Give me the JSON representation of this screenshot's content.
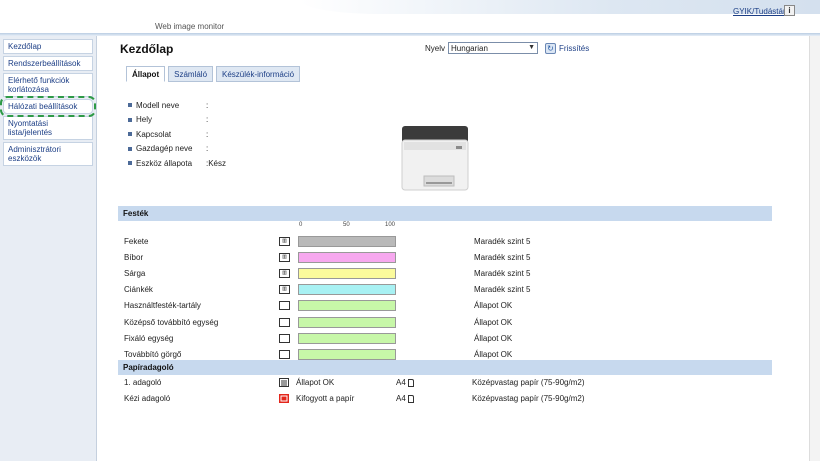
{
  "header": {
    "app_title": "Web image monitor",
    "help_link": "GYIK/Tudástár",
    "info_button": "i"
  },
  "sidebar": {
    "items": [
      {
        "label": "Kezdőlap"
      },
      {
        "label": "Rendszerbeállítások"
      },
      {
        "label": "Elérhető funkciók korlátozása"
      },
      {
        "label": "Hálózati beállítások"
      },
      {
        "label": "Nyomtatási lista/jelentés"
      },
      {
        "label": "Adminisztrátori eszközök"
      }
    ]
  },
  "main": {
    "title": "Kezdőlap",
    "language_label": "Nyelv",
    "language_value": "Hungarian",
    "refresh_label": "Frissítés",
    "tabs": [
      {
        "label": "Állapot"
      },
      {
        "label": "Számláló"
      },
      {
        "label": "Készülék-információ"
      }
    ],
    "info": [
      {
        "label": "Modell neve",
        "value": ":"
      },
      {
        "label": "Hely",
        "value": ":"
      },
      {
        "label": "Kapcsolat",
        "value": ":"
      },
      {
        "label": "Gazdagép neve",
        "value": ":"
      },
      {
        "label": "Eszköz állapota",
        "value": ":Kész"
      }
    ]
  },
  "toner": {
    "header": "Festék",
    "scale": [
      "0",
      "50",
      "100"
    ],
    "rows": [
      {
        "name": "Fekete",
        "status": "Maradék szint 5",
        "level": 1.0,
        "color": "#b9b9b9"
      },
      {
        "name": "Bíbor",
        "status": "Maradék szint 5",
        "level": 1.0,
        "color": "#f7a8ef"
      },
      {
        "name": "Sárga",
        "status": "Maradék szint 5",
        "level": 1.0,
        "color": "#fbfb9c"
      },
      {
        "name": "Ciánkék",
        "status": "Maradék szint 5",
        "level": 1.0,
        "color": "#a8f1f3"
      },
      {
        "name": "Használtfesték-tartály",
        "status": "Állapot OK",
        "level": 1.0,
        "color": "#c7f7a8"
      },
      {
        "name": "Középső továbbító egység",
        "status": "Állapot OK",
        "level": 1.0,
        "color": "#c7f7a8"
      },
      {
        "name": "Fixáló egység",
        "status": "Állapot OK",
        "level": 1.0,
        "color": "#c7f7a8"
      },
      {
        "name": "Továbbító görgő",
        "status": "Állapot OK",
        "level": 1.0,
        "color": "#c7f7a8"
      }
    ]
  },
  "paper": {
    "header": "Papíradagoló",
    "rows": [
      {
        "name": "1. adagoló",
        "status": "Állapot OK",
        "size": "A4",
        "type": "Középvastag papír (75-90g/m2)",
        "icon": "tray-ok-icon"
      },
      {
        "name": "Kézi adagoló",
        "status": "Kifogyott a papír",
        "size": "A4",
        "type": "Középvastag papír (75-90g/m2)",
        "icon": "tray-empty-icon"
      }
    ]
  }
}
